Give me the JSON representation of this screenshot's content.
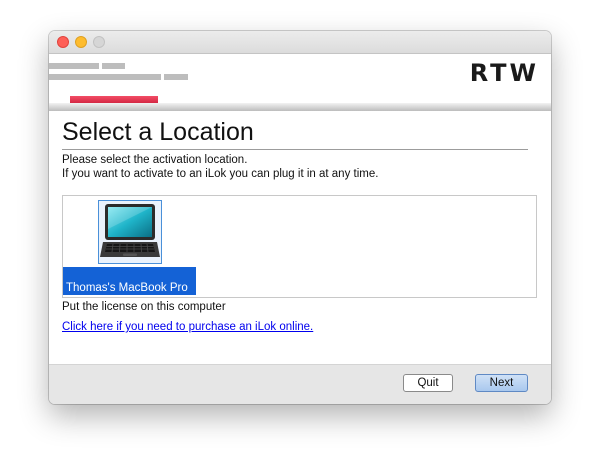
{
  "window": {
    "controls": [
      "close",
      "minimize",
      "zoom"
    ]
  },
  "header": {
    "logo_text": "RTW",
    "accent_color": "#e0314f"
  },
  "main": {
    "title": "Select a Location",
    "instruction_line1": "Please select the activation location.",
    "instruction_line2": "If you want to activate to an iLok you can plug it in at any time.",
    "locations": [
      {
        "label": "Thomas's MacBook Pro",
        "icon": "laptop-icon",
        "selected": true
      }
    ],
    "location_description": "Put the license on this computer",
    "purchase_link": "Click here if you need to purchase an iLok online."
  },
  "footer": {
    "quit_label": "Quit",
    "next_label": "Next"
  }
}
